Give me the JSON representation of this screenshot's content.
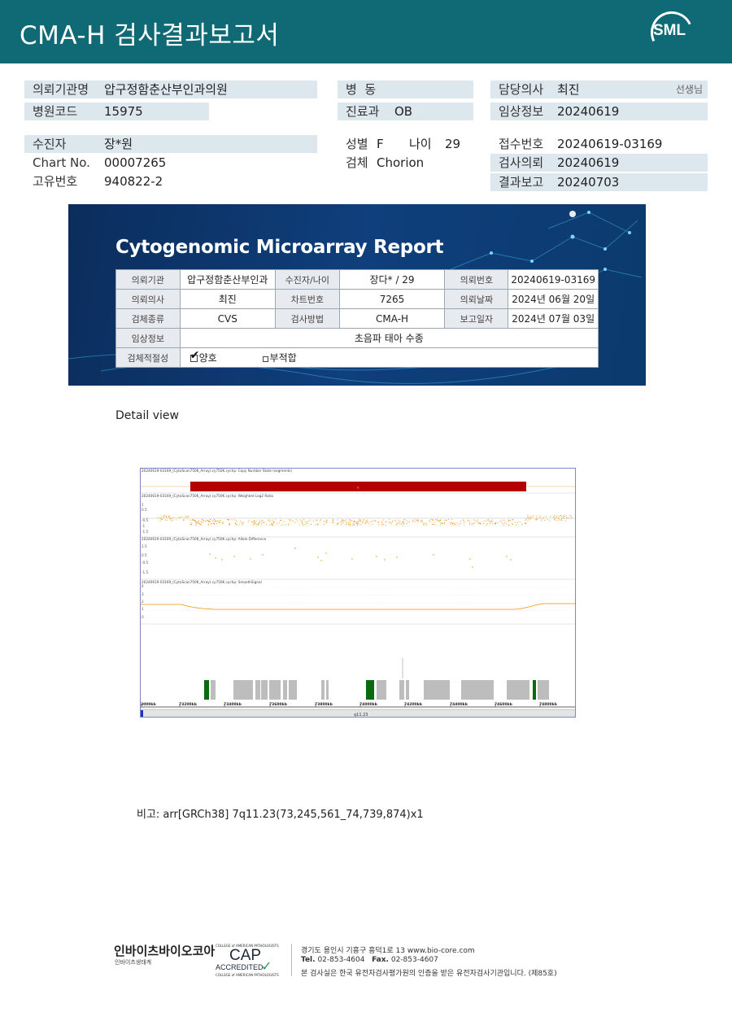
{
  "header": {
    "title": "CMA-H 검사결과보고서",
    "logo_text": "SML"
  },
  "patient_info": {
    "requesting_org": {
      "label": "의뢰기관명",
      "value": "압구정함춘산부인과의원"
    },
    "hospital_code": {
      "label": "병원코드",
      "value": "15975"
    },
    "ward": {
      "label": "병  동",
      "value": ""
    },
    "department": {
      "label": "진료과",
      "value": "OB"
    },
    "doctor": {
      "label": "담당의사",
      "value": "최진",
      "suffix": "선생님"
    },
    "clinical_info": {
      "label": "임상정보",
      "value": "20240619"
    },
    "patient": {
      "label": "수진자",
      "value": "장*원"
    },
    "chart_no": {
      "label": "Chart No.",
      "value": "00007265"
    },
    "unique_no": {
      "label": "고유번호",
      "value": "940822-2"
    },
    "sex": {
      "label": "성별",
      "value": "F"
    },
    "age": {
      "label": "나이",
      "value": "29"
    },
    "specimen": {
      "label": "검체",
      "value": "Chorion"
    },
    "receipt_no": {
      "label": "접수번호",
      "value": "20240619-03169"
    },
    "test_request": {
      "label": "검사의뢰",
      "value": "20240619"
    },
    "result_report": {
      "label": "결과보고",
      "value": "20240703"
    }
  },
  "report": {
    "title": "Cytogenomic Microarray Report",
    "rows": [
      [
        {
          "label": "의뢰기관",
          "value": "압구정함춘산부인과"
        },
        {
          "label": "수진자/나이",
          "value": "장다* / 29"
        },
        {
          "label": "의뢰번호",
          "value": "20240619-03169"
        }
      ],
      [
        {
          "label": "의뢰의사",
          "value": "최진"
        },
        {
          "label": "차트번호",
          "value": "7265"
        },
        {
          "label": "의뢰날짜",
          "value": "2024년 06월 20일"
        }
      ],
      [
        {
          "label": "검체종류",
          "value": "CVS"
        },
        {
          "label": "검사방법",
          "value": "CMA-H"
        },
        {
          "label": "보고일자",
          "value": "2024년 07월 03일"
        }
      ]
    ],
    "clinical": {
      "label": "임상정보",
      "value": "초음파 태아 수종"
    },
    "adequacy": {
      "label": "검체적절성",
      "good": "양호",
      "bad": "부적합"
    }
  },
  "detail": {
    "label": "Detail view"
  },
  "plot": {
    "track_titles": [
      "20240619-03169_(CytoScan750K_Array).cy750K.cychp: Copy Number State (segments)",
      "20240619-03169_(CytoScan750K_Array).cy750K.cychp: Weighted Log2 Ratio",
      "20240619-03169_(CytoScan750K_Array).cy750K.cychp: Allele Difference",
      "20240619-03169_(CytoScan750K_Array).cy750K.cychp: SmoothSignal"
    ],
    "log2_ticks": [
      "1",
      "0.5",
      "-0.5",
      "-1",
      "-1.5"
    ],
    "allele_ticks": [
      "1.5",
      "0.5",
      "-0.5",
      "-1.5"
    ],
    "smooth_ticks": [
      "4",
      "3",
      "2",
      "1",
      "0"
    ],
    "axis_labels": [
      "3000kb",
      "73200kb",
      "73400kb",
      "73600kb",
      "73800kb",
      "74000kb",
      "74200kb",
      "74400kb",
      "74600kb",
      "74800kb"
    ],
    "band_label": "q11.23",
    "colors": {
      "cn_loss": "#b40000",
      "points": "#f0900a",
      "gene": "#bdbdbd",
      "gene_highlight": "#0a6a10"
    }
  },
  "note": {
    "text": "비고: arr[GRCh38] 7q11.23(73,245,561_74,739,874)x1"
  },
  "footer": {
    "logo": "인바이츠바이오코아",
    "logo_sub": "인바이츠생태계",
    "cap_top": "COLLEGE of AMERICAN PATHOLOGISTS",
    "cap_main": "CAP",
    "cap_accredited": "ACCREDITED",
    "cap_bottom": "COLLEGE of AMERICAN PATHOLOGISTS",
    "address": "경기도 용인시 기흥구 흥덕1로 13   www.bio-core.com",
    "tel_label": "Tel.",
    "tel": "02-853-4604",
    "fax_label": "Fax.",
    "fax": "02-853-4607",
    "certification": "본 검사실은 한국 유전자검사평가원의 인증을 받은 유전자검사기관입니다. (제85호)"
  }
}
